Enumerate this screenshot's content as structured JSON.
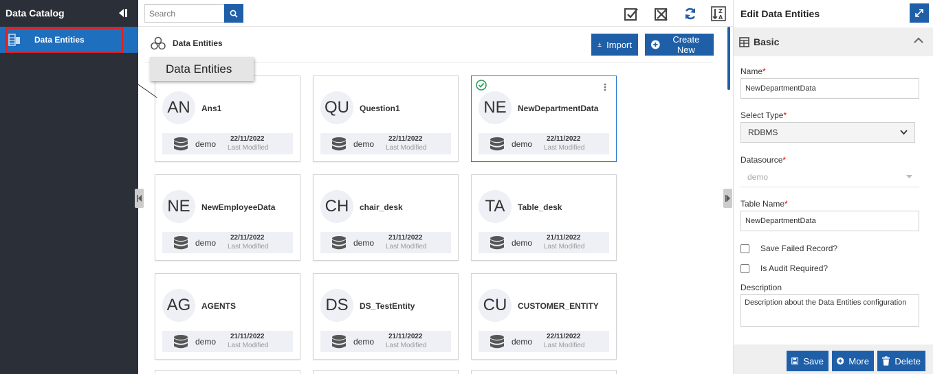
{
  "sidebar": {
    "title": "Data Catalog",
    "items": [
      {
        "label": "Data Entities"
      }
    ]
  },
  "toolbar": {
    "search_placeholder": "Search"
  },
  "breadcrumb": {
    "label": "Data Entities"
  },
  "actions": {
    "import_label": "Import",
    "create_label": "Create New"
  },
  "tooltip": {
    "text": "Data Entities"
  },
  "cards": [
    {
      "initials": "AN",
      "name": "Ans1",
      "datasource": "demo",
      "date": "22/11/2022",
      "modified_label": "Last Modified",
      "selected": false
    },
    {
      "initials": "QU",
      "name": "Question1",
      "datasource": "demo",
      "date": "22/11/2022",
      "modified_label": "Last Modified",
      "selected": false
    },
    {
      "initials": "NE",
      "name": "NewDepartmentData",
      "datasource": "demo",
      "date": "22/11/2022",
      "modified_label": "Last Modified",
      "selected": true
    },
    {
      "initials": "NE",
      "name": "NewEmployeeData",
      "datasource": "demo",
      "date": "22/11/2022",
      "modified_label": "Last Modified",
      "selected": false
    },
    {
      "initials": "CH",
      "name": "chair_desk",
      "datasource": "demo",
      "date": "21/11/2022",
      "modified_label": "Last Modified",
      "selected": false
    },
    {
      "initials": "TA",
      "name": "Table_desk",
      "datasource": "demo",
      "date": "21/11/2022",
      "modified_label": "Last Modified",
      "selected": false
    },
    {
      "initials": "AG",
      "name": "AGENTS",
      "datasource": "demo",
      "date": "21/11/2022",
      "modified_label": "Last Modified",
      "selected": false
    },
    {
      "initials": "DS",
      "name": "DS_TestEntity",
      "datasource": "demo",
      "date": "21/11/2022",
      "modified_label": "Last Modified",
      "selected": false
    },
    {
      "initials": "CU",
      "name": "CUSTOMER_ENTITY",
      "datasource": "demo",
      "date": "22/11/2022",
      "modified_label": "Last Modified",
      "selected": false
    }
  ],
  "panel": {
    "title": "Edit Data Entities",
    "section": "Basic",
    "fields": {
      "name_label": "Name",
      "name_value": "NewDepartmentData",
      "type_label": "Select Type",
      "type_value": "RDBMS",
      "datasource_label": "Datasource",
      "datasource_value": "demo",
      "table_label": "Table Name",
      "table_value": "NewDepartmentData",
      "save_failed_label": "Save Failed Record?",
      "audit_label": "Is Audit Required?",
      "description_label": "Description",
      "description_value": "Description about the Data Entities configuration"
    },
    "buttons": {
      "save": "Save",
      "more": "More",
      "delete": "Delete"
    }
  },
  "colors": {
    "primary": "#1f5fa8",
    "sidebar_bg": "#2b2f37",
    "selected_item": "#1f6fbf",
    "highlight": "#e02020",
    "success": "#2e9c5b"
  }
}
